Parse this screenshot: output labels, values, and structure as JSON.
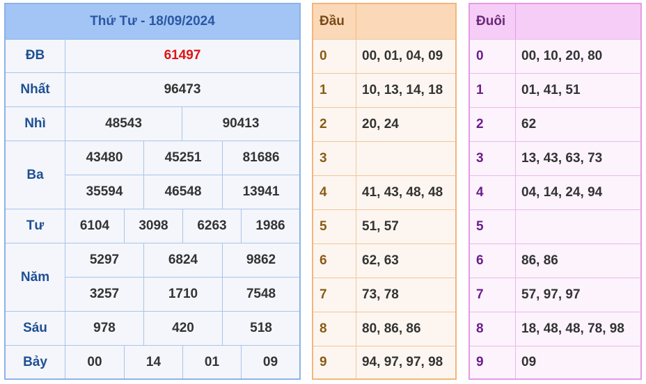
{
  "title": "Thứ Tư - 18/09/2024",
  "prizes": {
    "db": {
      "label": "ĐB",
      "values": [
        "61497"
      ]
    },
    "nhat": {
      "label": "Nhất",
      "values": [
        "96473"
      ]
    },
    "nhi": {
      "label": "Nhì",
      "values": [
        "48543",
        "90413"
      ]
    },
    "ba": {
      "label": "Ba",
      "values": [
        "43480",
        "45251",
        "81686",
        "35594",
        "46548",
        "13941"
      ]
    },
    "tu": {
      "label": "Tư",
      "values": [
        "6104",
        "3098",
        "6263",
        "1986"
      ]
    },
    "nam": {
      "label": "Năm",
      "values": [
        "5297",
        "6824",
        "9862",
        "3257",
        "1710",
        "7548"
      ]
    },
    "sau": {
      "label": "Sáu",
      "values": [
        "978",
        "420",
        "518"
      ]
    },
    "bay": {
      "label": "Bảy",
      "values": [
        "00",
        "14",
        "01",
        "09"
      ]
    }
  },
  "dau": {
    "header": "Đầu",
    "rows": [
      {
        "digit": "0",
        "values": "00, 01, 04, 09"
      },
      {
        "digit": "1",
        "values": "10, 13, 14, 18"
      },
      {
        "digit": "2",
        "values": "20, 24"
      },
      {
        "digit": "3",
        "values": ""
      },
      {
        "digit": "4",
        "values": "41, 43, 48, 48"
      },
      {
        "digit": "5",
        "values": "51, 57"
      },
      {
        "digit": "6",
        "values": "62, 63"
      },
      {
        "digit": "7",
        "values": "73, 78"
      },
      {
        "digit": "8",
        "values": "80, 86, 86"
      },
      {
        "digit": "9",
        "values": "94, 97, 97, 98"
      }
    ]
  },
  "duoi": {
    "header": "Đuôi",
    "rows": [
      {
        "digit": "0",
        "values": "00, 10, 20, 80"
      },
      {
        "digit": "1",
        "values": "01, 41, 51"
      },
      {
        "digit": "2",
        "values": "62"
      },
      {
        "digit": "3",
        "values": "13, 43, 63, 73"
      },
      {
        "digit": "4",
        "values": "04, 14, 24, 94"
      },
      {
        "digit": "5",
        "values": ""
      },
      {
        "digit": "6",
        "values": "86, 86"
      },
      {
        "digit": "7",
        "values": "57, 97, 97"
      },
      {
        "digit": "8",
        "values": "18, 48, 48, 78, 98"
      },
      {
        "digit": "9",
        "values": "09"
      }
    ]
  },
  "colors": {
    "special_prize": "#e01414",
    "label_blue": "#1e4f93",
    "dau_border": "#f2b67a",
    "duoi_border": "#e59ae6"
  }
}
